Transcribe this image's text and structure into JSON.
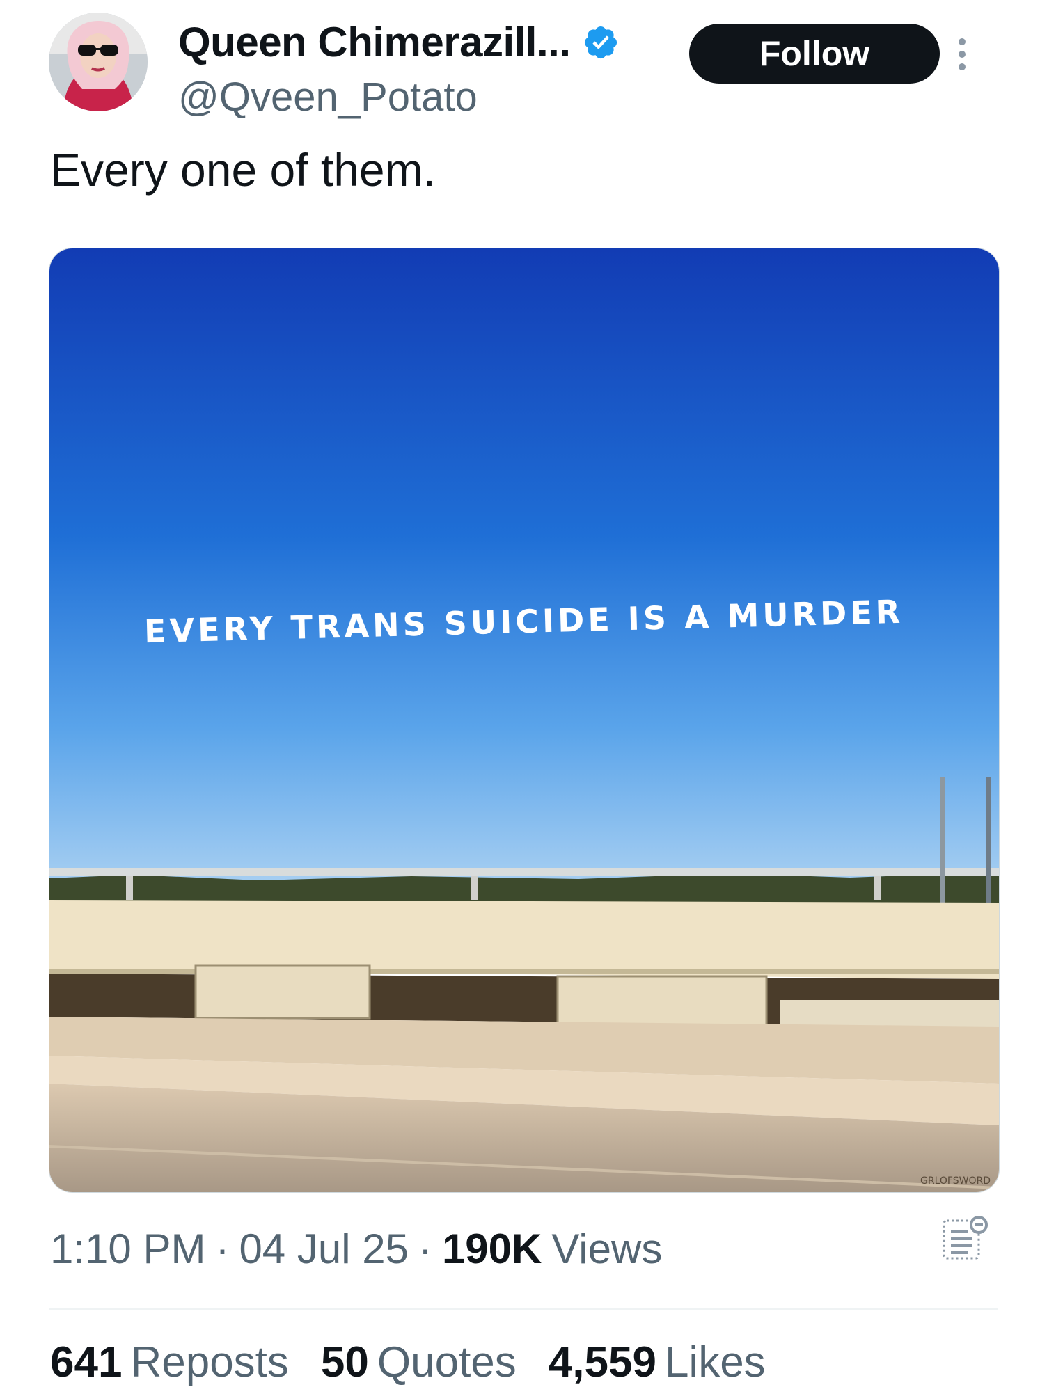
{
  "author": {
    "display_name": "Queen Chimerazill...",
    "handle": "@Qveen_Potato",
    "verified": true,
    "avatar_icon": "profile-photo"
  },
  "actions": {
    "follow_label": "Follow",
    "more_icon": "more-vertical-icon"
  },
  "tweet": {
    "text": "Every one of them."
  },
  "media": {
    "sign_text": "EVERY TRANS SUICIDE IS A MURDER",
    "watermark": "GRLOFSWORD"
  },
  "meta": {
    "time": "1:10 PM",
    "separator": "·",
    "date": "04 Jul 25",
    "views_count": "190K",
    "views_label": "Views"
  },
  "stats": {
    "reposts_count": "641",
    "reposts_label": "Reposts",
    "quotes_count": "50",
    "quotes_label": "Quotes",
    "likes_count": "4,559",
    "likes_label": "Likes"
  },
  "colors": {
    "primary_text": "#0f1419",
    "secondary_text": "#536471",
    "verified_blue": "#1d9bf0",
    "follow_bg": "#0f1419"
  }
}
